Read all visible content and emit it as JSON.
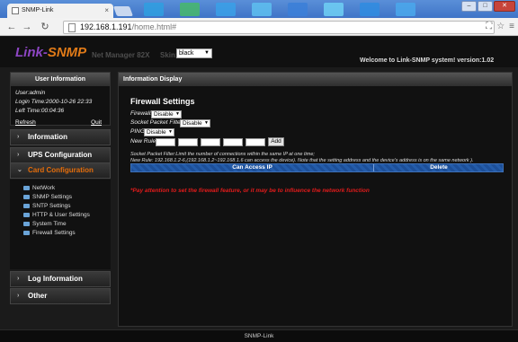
{
  "browser": {
    "tab_title": "SNMP-Link",
    "tab_close": "×",
    "url_host": "192.168.1.191",
    "url_path": "/home.html#"
  },
  "header": {
    "logo_part1": "Link",
    "logo_sep": "-",
    "logo_part2": "SNMP",
    "subtitle": "Net Manager 82X",
    "skin_label": "Skin:",
    "skin_value": "black",
    "welcome": "Welcome to Link-SNMP system! version:1.02"
  },
  "sidebar": {
    "user_info_title": "User Information",
    "user_line": "User:admin",
    "login_time": "Login Time:2000-10-26 22:33",
    "left_time": "Left Time:00:04:36",
    "refresh": "Refresh",
    "quit": "Quit",
    "menu": {
      "information": "Information",
      "ups_configuration": "UPS Configuration",
      "card_configuration": "Card Configuration",
      "log_information": "Log Information",
      "other": "Other"
    },
    "card_items": [
      "NetWork",
      "SNMP Settings",
      "SNTP Settings",
      "HTTP & User Settings",
      "System Time",
      "Firewall Settings"
    ]
  },
  "content": {
    "panel_title": "Information Display",
    "section_title": "Firewall Settings",
    "firewall_label": "Firewall:",
    "firewall_value": "Disable",
    "socket_label": "Socket Packet Filter:",
    "socket_value": "Disable",
    "ping_label": "PING:",
    "ping_value": "Disable",
    "new_rule_label": "New Rule:",
    "add_button": "Add",
    "note1": "Socket Packet Filter:Limit the number of connections within the same IP at one time;",
    "note2": "New Rule:  192.168.1.2-6,(192.168.1.2~192.168.1.6 can access the device).  Note that the setting address and the device's address is on the same network ).",
    "col_access_ip": "Can Access IP",
    "col_delete": "Delete",
    "warning": "*Pay attention to set the firewall feature, or it may be to influence the network function"
  },
  "footer": {
    "text": "SNMP-Link"
  },
  "colors": {
    "accent_orange": "#e36c0a",
    "logo_purple": "#8d46c4",
    "warning_red": "#e11b1b",
    "table_header_blue": "#1d4f98"
  }
}
